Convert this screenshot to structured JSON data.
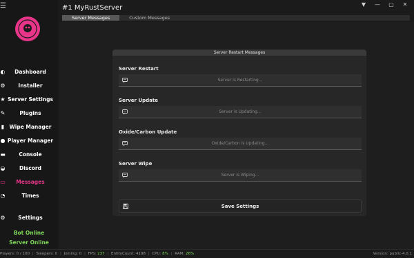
{
  "window": {
    "title": "#1 MyRustServer"
  },
  "tabs": [
    {
      "label": "Server Messages",
      "active": true
    },
    {
      "label": "Custom Messages",
      "active": false
    }
  ],
  "sidebar": {
    "items": [
      {
        "label": "Dashboard",
        "icon": "dashboard-icon"
      },
      {
        "label": "Installer",
        "icon": "installer-icon"
      },
      {
        "label": "Server Settings",
        "icon": "settings-icon"
      },
      {
        "label": "Plugins",
        "icon": "plugins-icon"
      },
      {
        "label": "Wipe Manager",
        "icon": "wipe-icon"
      },
      {
        "label": "Player Manager",
        "icon": "player-icon"
      },
      {
        "label": "Console",
        "icon": "console-icon"
      },
      {
        "label": "Discord",
        "icon": "discord-icon"
      },
      {
        "label": "Messages",
        "icon": "messages-icon",
        "active": true
      },
      {
        "label": "Times",
        "icon": "clock-icon"
      }
    ],
    "settings_label": "Settings",
    "bot_status": "Bot Online",
    "server_status": "Server Online"
  },
  "panel": {
    "title": "Server Restart Messages",
    "fields": [
      {
        "label": "Server Restart",
        "placeholder": "Server is Restarting..."
      },
      {
        "label": "Server Update",
        "placeholder": "Server is Updating..."
      },
      {
        "label": "Oxide/Carbon Update",
        "placeholder": "Oxide/Carbon is Updating..."
      },
      {
        "label": "Server Wipe",
        "placeholder": "Server is Wiping..."
      }
    ],
    "save_label": "Save Settings"
  },
  "statusbar": {
    "players_label": "Players:",
    "players_value": "0 / 100",
    "sleepers_label": "Sleepers:",
    "sleepers_value": "0",
    "joining_label": "Joining:",
    "joining_value": "0",
    "fps_label": "FPS:",
    "fps_value": "237",
    "entity_label": "EntityCount:",
    "entity_value": "4198",
    "cpu_label": "CPU:",
    "cpu_value": "8%",
    "ram_label": "RAM:",
    "ram_value": "26%",
    "version": "Version: public-4.0.1"
  },
  "colors": {
    "accent": "#e8358a",
    "online": "#7fd55b"
  }
}
